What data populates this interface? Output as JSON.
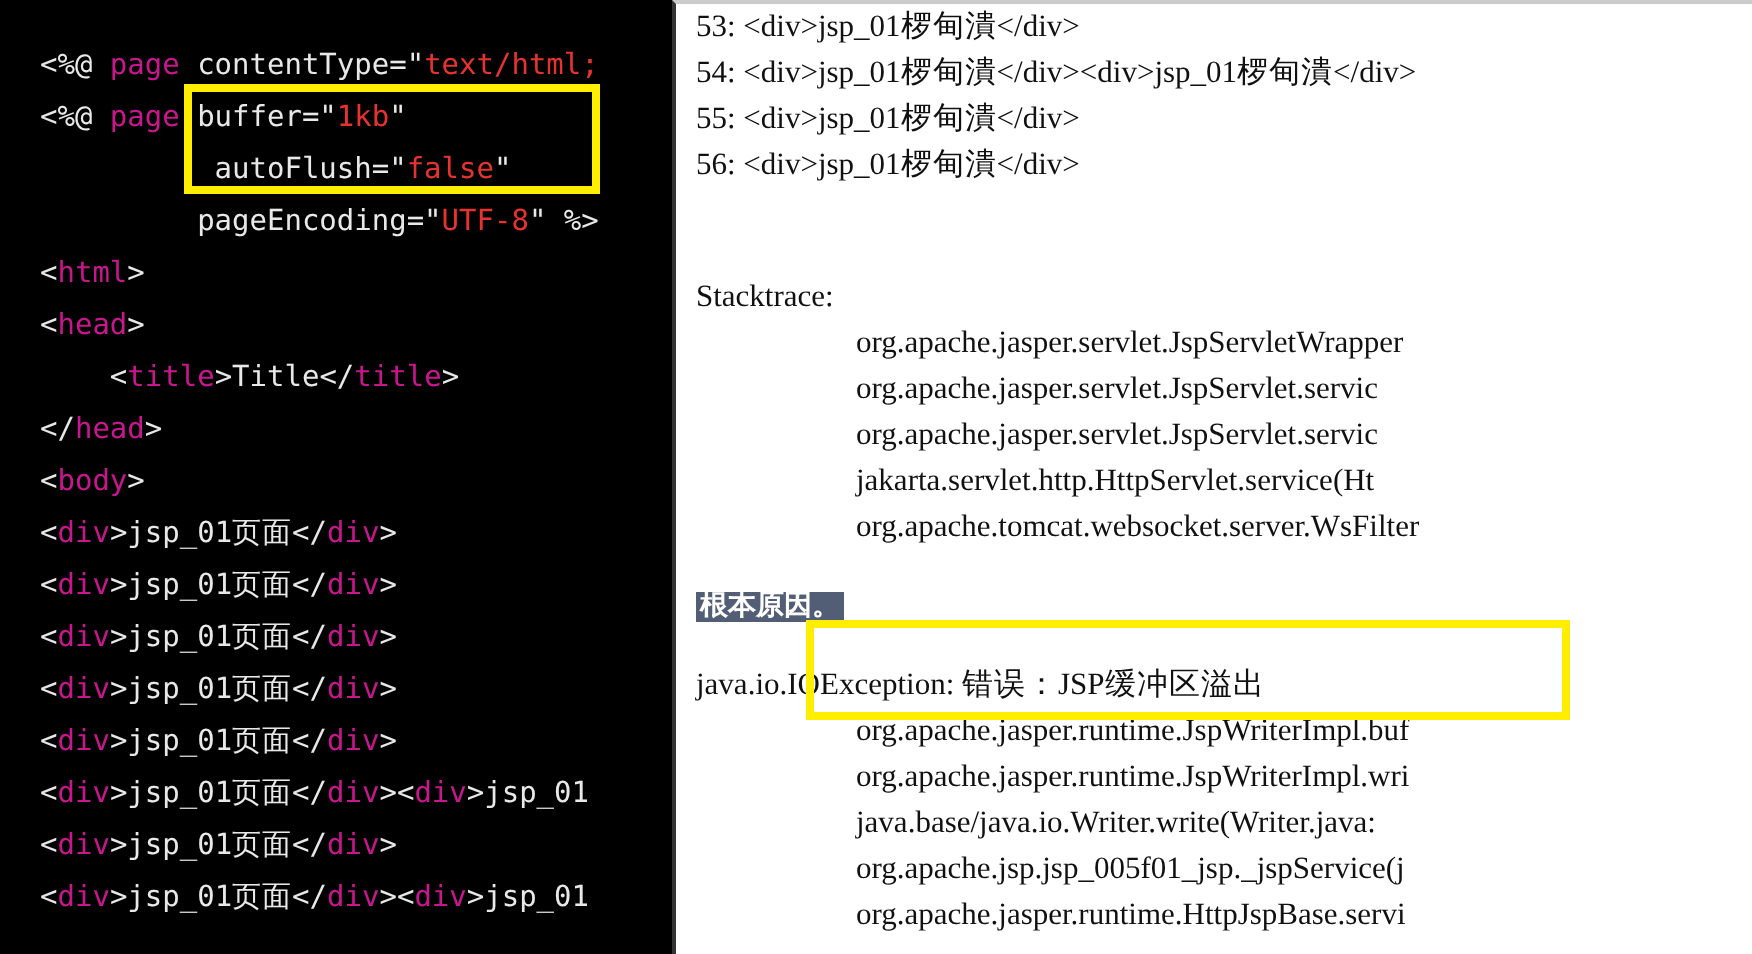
{
  "editor": {
    "lines": [
      [
        {
          "kind": "plain",
          "text": "<%@ "
        },
        {
          "kind": "keyword",
          "text": "page"
        },
        {
          "kind": "plain",
          "text": " contentType=\""
        },
        {
          "kind": "string",
          "text": "text/html;"
        }
      ],
      [
        {
          "kind": "plain",
          "text": "<%@ "
        },
        {
          "kind": "keyword",
          "text": "page"
        },
        {
          "kind": "plain",
          "text": " buffer=\""
        },
        {
          "kind": "string",
          "text": "1kb"
        },
        {
          "kind": "plain",
          "text": "\""
        }
      ],
      [
        {
          "kind": "plain",
          "text": "          autoFlush=\""
        },
        {
          "kind": "string",
          "text": "false"
        },
        {
          "kind": "plain",
          "text": "\""
        }
      ],
      [
        {
          "kind": "plain",
          "text": "         pageEncoding=\""
        },
        {
          "kind": "string",
          "text": "UTF-8"
        },
        {
          "kind": "plain",
          "text": "\" %>"
        }
      ],
      [
        {
          "kind": "plain",
          "text": "<"
        },
        {
          "kind": "keyword",
          "text": "html"
        },
        {
          "kind": "plain",
          "text": ">"
        }
      ],
      [
        {
          "kind": "plain",
          "text": "<"
        },
        {
          "kind": "keyword",
          "text": "head"
        },
        {
          "kind": "plain",
          "text": ">"
        }
      ],
      [
        {
          "kind": "plain",
          "text": "    <"
        },
        {
          "kind": "keyword",
          "text": "title"
        },
        {
          "kind": "plain",
          "text": ">Title</"
        },
        {
          "kind": "keyword",
          "text": "title"
        },
        {
          "kind": "plain",
          "text": ">"
        }
      ],
      [
        {
          "kind": "plain",
          "text": "</"
        },
        {
          "kind": "keyword",
          "text": "head"
        },
        {
          "kind": "plain",
          "text": ">"
        }
      ],
      [
        {
          "kind": "plain",
          "text": "<"
        },
        {
          "kind": "keyword",
          "text": "body"
        },
        {
          "kind": "plain",
          "text": ">"
        }
      ],
      [
        {
          "kind": "plain",
          "text": "<"
        },
        {
          "kind": "keyword",
          "text": "div"
        },
        {
          "kind": "plain",
          "text": ">jsp_01页面</"
        },
        {
          "kind": "keyword",
          "text": "div"
        },
        {
          "kind": "plain",
          "text": ">"
        }
      ],
      [
        {
          "kind": "plain",
          "text": "<"
        },
        {
          "kind": "keyword",
          "text": "div"
        },
        {
          "kind": "plain",
          "text": ">jsp_01页面</"
        },
        {
          "kind": "keyword",
          "text": "div"
        },
        {
          "kind": "plain",
          "text": ">"
        }
      ],
      [
        {
          "kind": "plain",
          "text": "<"
        },
        {
          "kind": "keyword",
          "text": "div"
        },
        {
          "kind": "plain",
          "text": ">jsp_01页面</"
        },
        {
          "kind": "keyword",
          "text": "div"
        },
        {
          "kind": "plain",
          "text": ">"
        }
      ],
      [
        {
          "kind": "plain",
          "text": "<"
        },
        {
          "kind": "keyword",
          "text": "div"
        },
        {
          "kind": "plain",
          "text": ">jsp_01页面</"
        },
        {
          "kind": "keyword",
          "text": "div"
        },
        {
          "kind": "plain",
          "text": ">"
        }
      ],
      [
        {
          "kind": "plain",
          "text": "<"
        },
        {
          "kind": "keyword",
          "text": "div"
        },
        {
          "kind": "plain",
          "text": ">jsp_01页面</"
        },
        {
          "kind": "keyword",
          "text": "div"
        },
        {
          "kind": "plain",
          "text": ">"
        }
      ],
      [
        {
          "kind": "plain",
          "text": "<"
        },
        {
          "kind": "keyword",
          "text": "div"
        },
        {
          "kind": "plain",
          "text": ">jsp_01页面</"
        },
        {
          "kind": "keyword",
          "text": "div"
        },
        {
          "kind": "plain",
          "text": "><"
        },
        {
          "kind": "keyword",
          "text": "div"
        },
        {
          "kind": "plain",
          "text": ">jsp_01"
        }
      ],
      [
        {
          "kind": "plain",
          "text": "<"
        },
        {
          "kind": "keyword",
          "text": "div"
        },
        {
          "kind": "plain",
          "text": ">jsp_01页面</"
        },
        {
          "kind": "keyword",
          "text": "div"
        },
        {
          "kind": "plain",
          "text": ">"
        }
      ],
      [
        {
          "kind": "plain",
          "text": "<"
        },
        {
          "kind": "keyword",
          "text": "div"
        },
        {
          "kind": "plain",
          "text": ">jsp_01页面</"
        },
        {
          "kind": "keyword",
          "text": "div"
        },
        {
          "kind": "plain",
          "text": "><"
        },
        {
          "kind": "keyword",
          "text": "div"
        },
        {
          "kind": "plain",
          "text": ">jsp_01"
        }
      ]
    ]
  },
  "error_page": {
    "source_lines": [
      "53: <div>jsp_01椤甸潰</div>",
      "54: <div>jsp_01椤甸潰</div><div>jsp_01椤甸潰</div>",
      "55: <div>jsp_01椤甸潰</div>",
      "56: <div>jsp_01椤甸潰</div>"
    ],
    "stacktrace_label": "Stacktrace:",
    "stacktrace": [
      "org.apache.jasper.servlet.JspServletWrapper",
      "org.apache.jasper.servlet.JspServlet.servic",
      "org.apache.jasper.servlet.JspServlet.servic",
      "jakarta.servlet.http.HttpServlet.service(Ht",
      "org.apache.tomcat.websocket.server.WsFilter"
    ],
    "root_cause_heading": "根本原因。",
    "exception": "java.io.IOException: 错误：JSP缓冲区溢出",
    "cause_trace": [
      "org.apache.jasper.runtime.JspWriterImpl.buf",
      "org.apache.jasper.runtime.JspWriterImpl.wri",
      "java.base/java.io.Writer.write(Writer.java:",
      "org.apache.jsp.jsp_005f01_jsp._jspService(j",
      "org.apache.jasper.runtime.HttpJspBase.servi"
    ]
  }
}
